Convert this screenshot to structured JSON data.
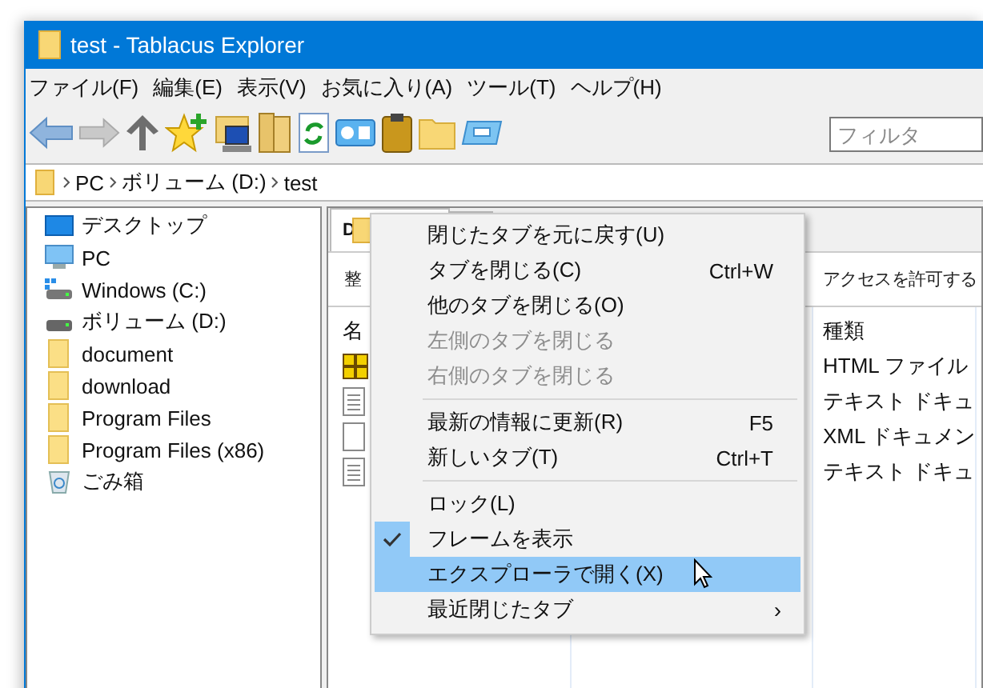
{
  "window": {
    "title": "test - Tablacus Explorer"
  },
  "menu_bar": [
    "ファイル(F)",
    "編集(E)",
    "表示(V)",
    "お気に入り(A)",
    "ツール(T)",
    "ヘルプ(H)"
  ],
  "filter": {
    "placeholder": "フィルタ"
  },
  "address_bar": {
    "segments": [
      "PC",
      "ボリューム (D:)",
      "test"
    ]
  },
  "tree": {
    "items": [
      {
        "label": "デスクトップ",
        "kind": "desktop"
      },
      {
        "label": "PC",
        "kind": "pc"
      },
      {
        "label": "Windows (C:)",
        "kind": "system-drive"
      },
      {
        "label": "ボリューム (D:)",
        "kind": "drive"
      },
      {
        "label": "document",
        "kind": "folder"
      },
      {
        "label": "download",
        "kind": "folder"
      },
      {
        "label": "Program Files",
        "kind": "folder"
      },
      {
        "label": "Program Files (x86)",
        "kind": "folder"
      },
      {
        "label": "ごみ箱",
        "kind": "recycle"
      }
    ]
  },
  "tabs": [
    {
      "label": "D",
      "selected": true
    }
  ],
  "command_bar": [
    "整",
    "アクセスを許可する"
  ],
  "file_list": {
    "columns": [
      "名",
      "種類"
    ],
    "rows": [
      {
        "kind": "html",
        "type": "HTML ファイル"
      },
      {
        "kind": "text",
        "type": "テキスト ドキュ"
      },
      {
        "kind": "blank",
        "type": "XML ドキュメン"
      },
      {
        "kind": "text",
        "type": "テキスト ドキュ"
      }
    ]
  },
  "context_menu": {
    "items": [
      {
        "kind": "item",
        "label": "閉じたタブを元に戻す(U)",
        "disabled": false,
        "checked": false,
        "selected": false
      },
      {
        "kind": "item",
        "label": "タブを閉じる(C)",
        "shortcut": "Ctrl+W",
        "disabled": false,
        "checked": false,
        "selected": false
      },
      {
        "kind": "item",
        "label": "他のタブを閉じる(O)",
        "disabled": false,
        "checked": false,
        "selected": false
      },
      {
        "kind": "item",
        "label": "左側のタブを閉じる",
        "disabled": true,
        "checked": false,
        "selected": false
      },
      {
        "kind": "item",
        "label": "右側のタブを閉じる",
        "disabled": true,
        "checked": false,
        "selected": false
      },
      {
        "kind": "separator"
      },
      {
        "kind": "item",
        "label": "最新の情報に更新(R)",
        "shortcut": "F5",
        "disabled": false,
        "checked": false,
        "selected": false
      },
      {
        "kind": "item",
        "label": "新しいタブ(T)",
        "shortcut": "Ctrl+T",
        "disabled": false,
        "checked": false,
        "selected": false
      },
      {
        "kind": "separator"
      },
      {
        "kind": "item",
        "label": "ロック(L)",
        "disabled": false,
        "checked": false,
        "selected": false
      },
      {
        "kind": "item",
        "label": "フレームを表示",
        "disabled": false,
        "checked": true,
        "selected": false
      },
      {
        "kind": "item",
        "label": "エクスプローラで開く(X)",
        "disabled": false,
        "checked": false,
        "selected": true
      },
      {
        "kind": "item",
        "label": "最近閉じたタブ",
        "submenu": "›",
        "disabled": false,
        "checked": false,
        "selected": false
      }
    ]
  }
}
